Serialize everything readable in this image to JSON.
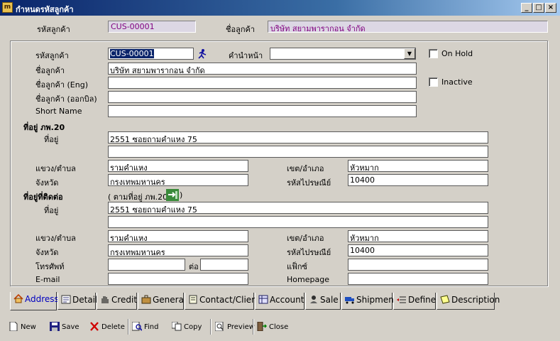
{
  "window": {
    "title": "กำหนดรหัสลูกค้า",
    "icon_text": "m"
  },
  "header": {
    "code_label": "รหัสลูกค้า",
    "code_value": "CUS-00001",
    "name_label": "ชื่อลูกค้า",
    "name_value": "บริษัท สยามพารากอน จำกัด"
  },
  "form": {
    "code_label": "รหัสลูกค้า",
    "code_value": "CUS-00001",
    "prefix_label": "คำนำหน้า",
    "prefix_value": "",
    "onhold_label": "On Hold",
    "inactive_label": "Inactive",
    "name_label": "ชื่อลูกค้า",
    "name_value": "บริษัท สยามพารากอน จำกัด",
    "name_eng_label": "ชื่อลูกค้า (Eng)",
    "name_eng_value": "",
    "name_bill_label": "ชื่อลูกค้า (ออกบิล)",
    "name_bill_value": "",
    "short_label": "Short Name",
    "short_value": "",
    "tax_address_title": "ที่อยู่ ภพ.20",
    "address_label": "ที่อยู่",
    "tax_addr1": "2551 ซอยถามคำแหง 75",
    "tax_addr2": "",
    "subdistrict_label": "แขวง/ตำบล",
    "tax_subdistrict": "รามคำแหง",
    "district_label": "เขต/อำเภอ",
    "tax_district": "หัวหมาก",
    "province_label": "จังหวัด",
    "tax_province": "กรุงเทพมหานคร",
    "postcode_label": "รหัสไปรษณีย์",
    "tax_postcode": "10400",
    "contact_address_title": "ที่อยู่ที่ติดต่อ",
    "same_as_label_open": "( ตามที่อยู่ ภพ.20",
    "same_as_label_close": ")",
    "ct_addr1": "2551 ซอยถามคำแหง 75",
    "ct_addr2": "",
    "ct_subdistrict": "รามคำแหง",
    "ct_district": "หัวหมาก",
    "ct_province": "กรุงเทพมหานคร",
    "ct_postcode": "10400",
    "phone_label": "โทรศัพท์",
    "phone_value": "",
    "ext_label": "ต่อ",
    "ext_value": "",
    "fax_label": "แฟ็กซ์",
    "fax_value": "",
    "email_label": "E-mail",
    "email_value": "",
    "homepage_label": "Homepage",
    "homepage_value": ""
  },
  "tabs": [
    "Address",
    "Detail",
    "Credit",
    "General",
    "Contact/Client",
    "Account",
    "Sale",
    "Shipment",
    "Define",
    "Description"
  ],
  "toolbar": {
    "new": "New",
    "save": "Save",
    "delete": "Delete",
    "find": "Find",
    "copy": "Copy",
    "preview": "Preview",
    "close": "Close"
  },
  "colors": {
    "titlebar": "#0a246a",
    "header_value": "#800080",
    "active_tab": "#0000c0"
  }
}
